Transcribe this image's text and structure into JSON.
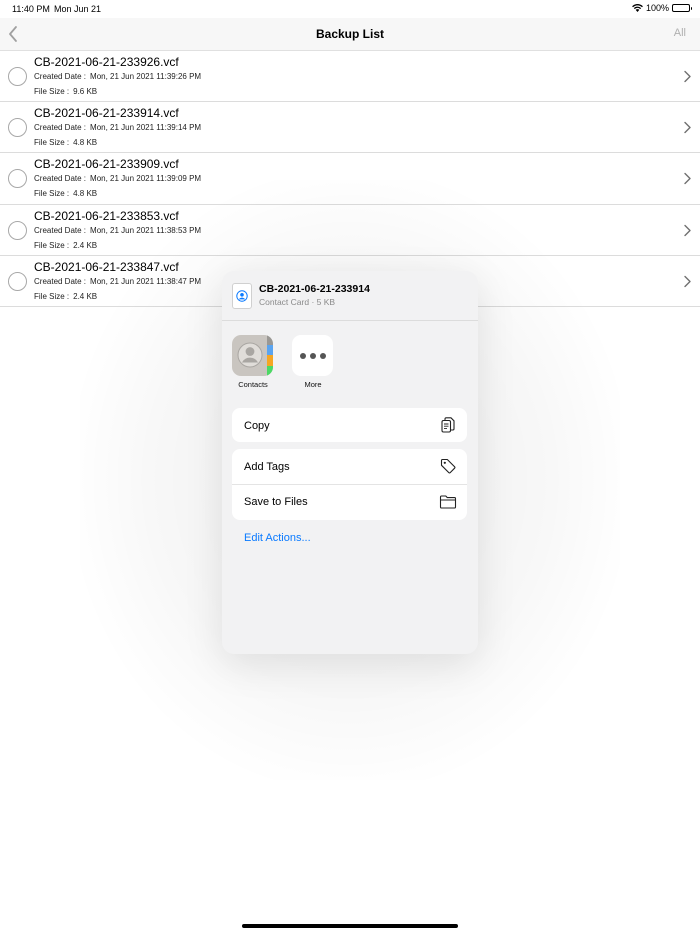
{
  "status_bar": {
    "time": "11:40 PM",
    "date": "Mon Jun 21",
    "battery": "100%",
    "battery_level": 1.0
  },
  "nav": {
    "back_icon": "chevron-left-icon",
    "title": "Backup List",
    "right_button": "All"
  },
  "labels": {
    "created_date": "Created Date :",
    "file_size": "File Size :"
  },
  "rows": [
    {
      "name": "CB-2021-06-21-233926.vcf",
      "created": "Mon, 21 Jun 2021 11:39:26 PM",
      "size": "9.6 KB"
    },
    {
      "name": "CB-2021-06-21-233914.vcf",
      "created": "Mon, 21 Jun 2021 11:39:14 PM",
      "size": "4.8 KB"
    },
    {
      "name": "CB-2021-06-21-233909.vcf",
      "created": "Mon, 21 Jun 2021 11:39:09 PM",
      "size": "4.8 KB"
    },
    {
      "name": "CB-2021-06-21-233853.vcf",
      "created": "Mon, 21 Jun 2021 11:38:53 PM",
      "size": "2.4 KB"
    },
    {
      "name": "CB-2021-06-21-233847.vcf",
      "created": "Mon, 21 Jun 2021 11:38:47 PM",
      "size": "2.4 KB"
    }
  ],
  "share_sheet": {
    "file_title": "CB-2021-06-21-233914",
    "file_subtitle": "Contact Card · 5 KB",
    "apps": [
      {
        "label": "Contacts",
        "icon": "contacts-app-icon"
      },
      {
        "label": "More",
        "icon": "more-icon"
      }
    ],
    "actions_group1": [
      {
        "label": "Copy",
        "icon": "copy-icon"
      }
    ],
    "actions_group2": [
      {
        "label": "Add Tags",
        "icon": "tag-icon"
      },
      {
        "label": "Save to Files",
        "icon": "folder-icon"
      }
    ],
    "edit_actions": "Edit Actions..."
  },
  "colors": {
    "accent": "#0a7aff",
    "nav_background": "#f7f7f7",
    "sheet_background": "#f2f2f3",
    "disabled_text": "#b0b0b0"
  }
}
